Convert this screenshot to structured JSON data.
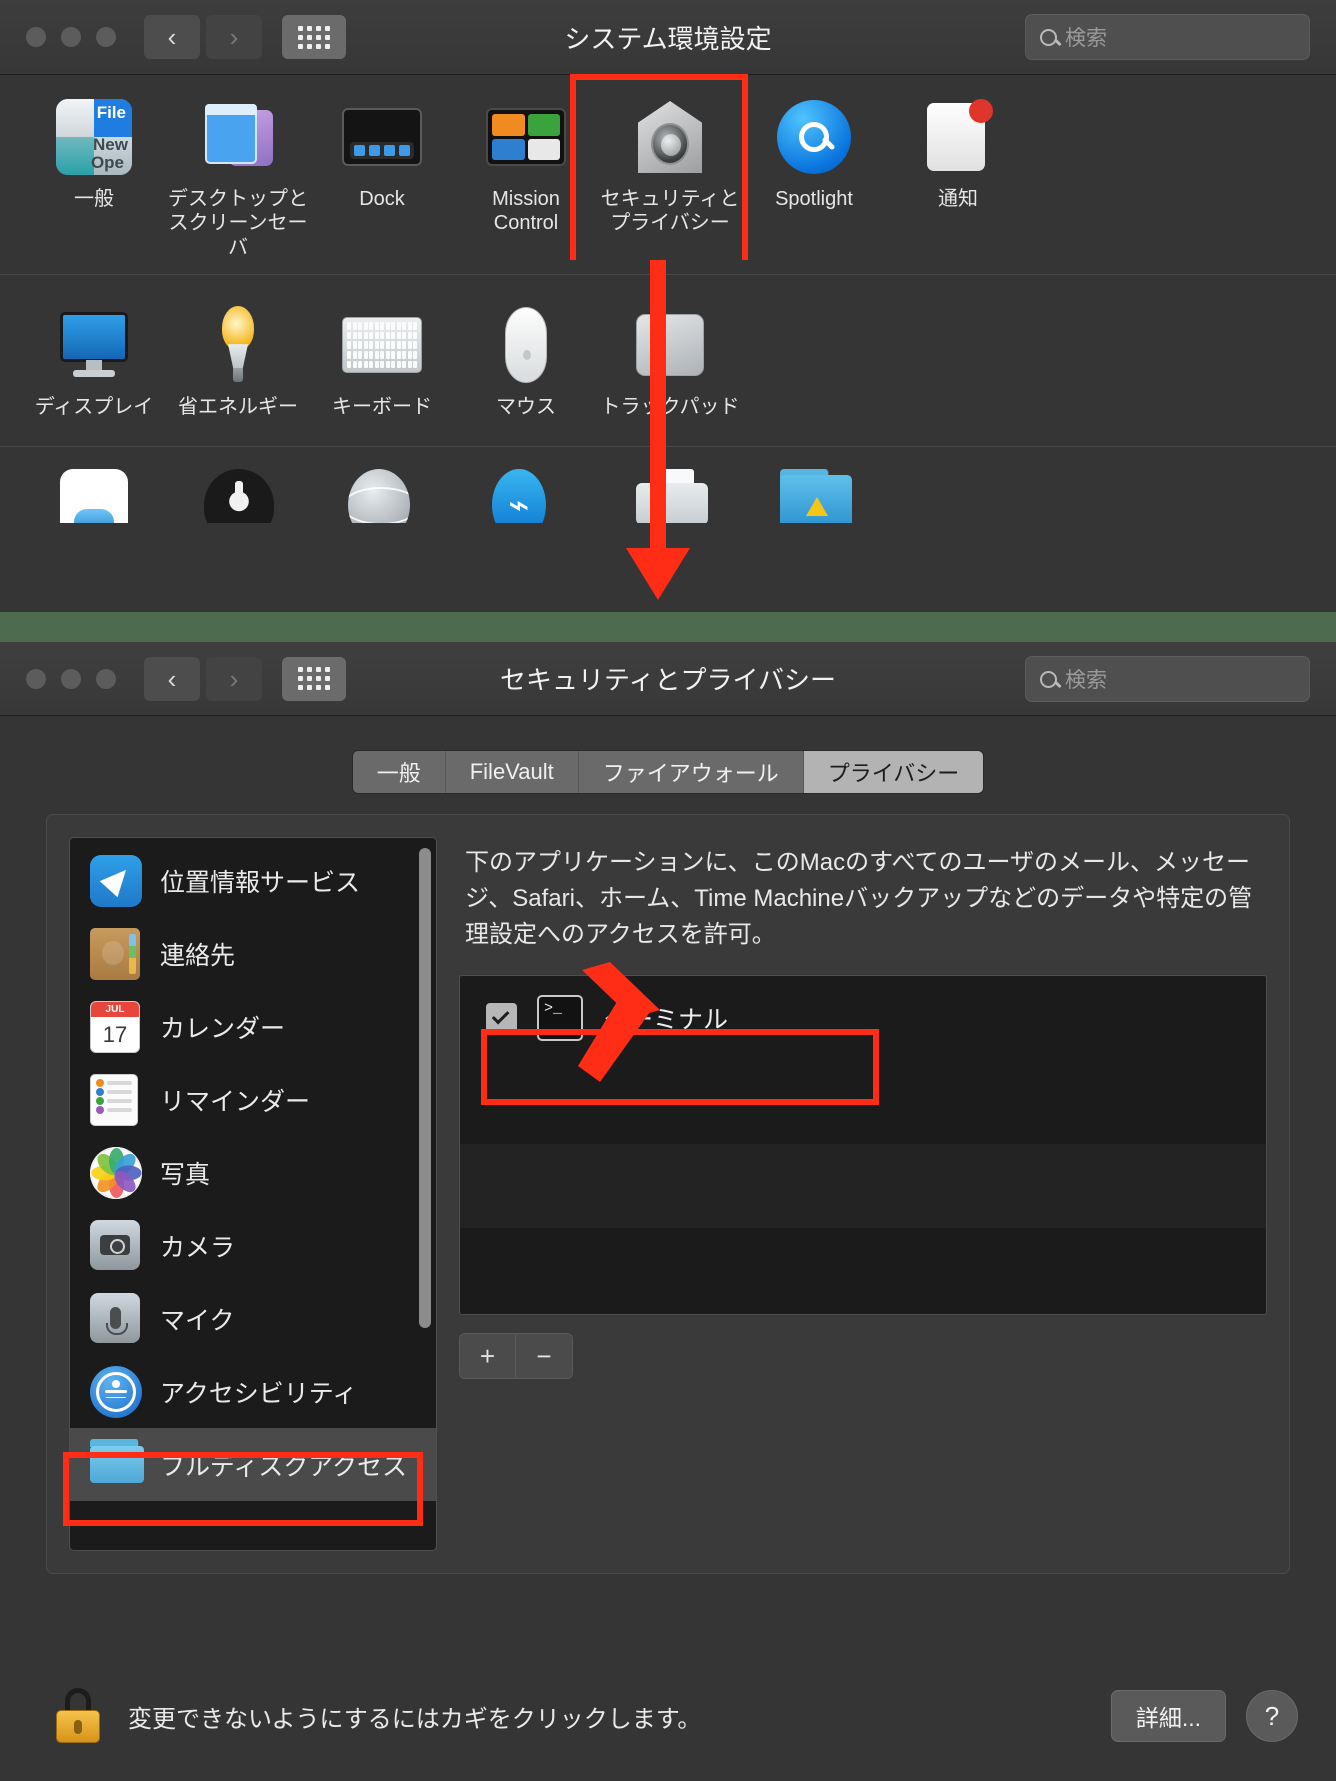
{
  "window1": {
    "title": "システム環境設定",
    "search_placeholder": "検索",
    "nav": {
      "back_label": "‹",
      "forward_label": "›",
      "grid_label": "grid"
    },
    "rows": [
      {
        "items": [
          {
            "label": "一般",
            "icon": "general-icon",
            "general_text": [
              "File",
              "New",
              "Ope"
            ]
          },
          {
            "label": "デスクトップと\nスクリーンセーバ",
            "icon": "desktop-screensaver-icon"
          },
          {
            "label": "Dock",
            "icon": "dock-icon"
          },
          {
            "label": "Mission\nControl",
            "icon": "mission-control-icon"
          },
          {
            "label": "セキュリティと\nプライバシー",
            "icon": "security-privacy-icon"
          },
          {
            "label": "Spotlight",
            "icon": "spotlight-icon"
          },
          {
            "label": "通知",
            "icon": "notifications-icon"
          }
        ]
      },
      {
        "items": [
          {
            "label": "ディスプレイ",
            "icon": "display-icon"
          },
          {
            "label": "省エネルギー",
            "icon": "energy-saver-icon"
          },
          {
            "label": "キーボード",
            "icon": "keyboard-icon"
          },
          {
            "label": "マウス",
            "icon": "mouse-icon"
          },
          {
            "label": "トラックパッド",
            "icon": "trackpad-icon"
          }
        ]
      },
      {
        "items": [
          {
            "label": "",
            "icon": "icloud-icon"
          },
          {
            "label": "",
            "icon": "app-store-icon"
          },
          {
            "label": "",
            "icon": "network-icon"
          },
          {
            "label": "",
            "icon": "bluetooth-icon"
          },
          {
            "label": "",
            "icon": "printers-scanners-icon"
          },
          {
            "label": "",
            "icon": "sharing-icon"
          }
        ]
      }
    ]
  },
  "window2": {
    "title": "セキュリティとプライバシー",
    "search_placeholder": "検索",
    "tabs": [
      {
        "label": "一般",
        "active": false
      },
      {
        "label": "FileVault",
        "active": false
      },
      {
        "label": "ファイアウォール",
        "active": false
      },
      {
        "label": "プライバシー",
        "active": true
      }
    ],
    "sidebar": {
      "items": [
        {
          "label": "位置情報サービス",
          "icon": "location-services-icon",
          "selected": false
        },
        {
          "label": "連絡先",
          "icon": "contacts-icon",
          "selected": false
        },
        {
          "label": "カレンダー",
          "icon": "calendar-icon",
          "selected": false,
          "cal_month": "JUL",
          "cal_day": "17"
        },
        {
          "label": "リマインダー",
          "icon": "reminders-icon",
          "selected": false
        },
        {
          "label": "写真",
          "icon": "photos-icon",
          "selected": false
        },
        {
          "label": "カメラ",
          "icon": "camera-icon",
          "selected": false
        },
        {
          "label": "マイク",
          "icon": "microphone-icon",
          "selected": false
        },
        {
          "label": "アクセシビリティ",
          "icon": "accessibility-icon",
          "selected": false
        },
        {
          "label": "フルディスクアクセス",
          "icon": "full-disk-access-folder-icon",
          "selected": true
        }
      ]
    },
    "description": "下のアプリケーションに、このMacのすべてのユーザのメール、メッセージ、Safari、ホーム、Time Machineバックアップなどのデータや特定の管理設定へのアクセスを許可。",
    "app_list": [
      {
        "name": "ターミナル",
        "checked": true,
        "icon": "terminal-icon",
        "icon_glyph": ">_"
      }
    ],
    "list_buttons": {
      "add_label": "+",
      "remove_label": "−"
    },
    "bottom": {
      "lock_text": "変更できないようにするにはカギをクリックします。",
      "lock_icon": "unlocked-padlock-icon",
      "detail_label": "詳細...",
      "help_label": "?"
    }
  },
  "annotations": {
    "accent_color": "#ff2d16",
    "boxes": [
      "security-privacy-pref-icon",
      "terminal-row",
      "full-disk-access-sidebar-item"
    ],
    "arrows": [
      "down-arrow-to-window2-title",
      "up-arrow-to-terminal-row"
    ]
  },
  "colors": {
    "window_bg": "#353535",
    "titlebar_bg": "#3d3d3d",
    "list_bg": "#1b1b1b",
    "selected_tab_bg": "#b3b3b3",
    "divider_band": "#4d6b4f",
    "annotation_red": "#ff2d16"
  }
}
